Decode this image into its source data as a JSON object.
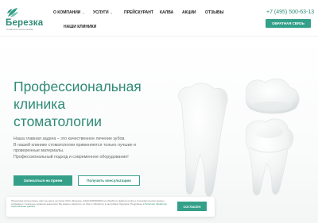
{
  "brand": {
    "name": "Березка",
    "tagline": "стоматологическая клиника",
    "color": "#2f8a76"
  },
  "nav": {
    "items": [
      {
        "label": "О КОМПАНИИ",
        "dropdown": true
      },
      {
        "label": "УСЛУГИ",
        "dropdown": true
      },
      {
        "label": "ПРЕЙСКУРАНТ",
        "dropdown": false
      },
      {
        "label": "КАЛВА",
        "dropdown": false
      },
      {
        "label": "АКЦИИ",
        "dropdown": false
      },
      {
        "label": "ОТЗЫВЫ",
        "dropdown": false
      },
      {
        "label": "НАШИ КЛИНИКИ",
        "dropdown": false
      }
    ],
    "chevron_icon": "chevron-down-icon"
  },
  "header": {
    "phone": "+7 (495) 500-63-13",
    "callback_label": "ОБРАТНАЯ СВЯЗЬ"
  },
  "hero": {
    "title_lines": [
      "Профессиональная",
      "клиника",
      "стоматологии"
    ],
    "text_lines": [
      "Наша главная задача – это качественное лечение зубов.",
      "В нашей клинике стоматологии применяются только лучшие и",
      "проверенные материалы.",
      "Профессиональный подход и современное оборудование!"
    ],
    "primary_button": "Записаться на прием",
    "secondary_button": "Получить консультацию",
    "image": "teeth-illustration"
  },
  "cookie": {
    "text": "Продолжая использовать сайт, вы даете согласие ООО «Березка» (ИНН 0000000000) на обработку файлов cookie и пользовательских данных, собранных с помощью сервисов аналитики. Вы можете запретить их сбор и обработку в настройках браузера. Подробнее в",
    "link": "Политике обработки персональных данных",
    "accept_label": "СОГЛАСЕН"
  },
  "colors": {
    "accent": "#35a08a",
    "accent_dark": "#2f8a76",
    "text": "#666666"
  }
}
